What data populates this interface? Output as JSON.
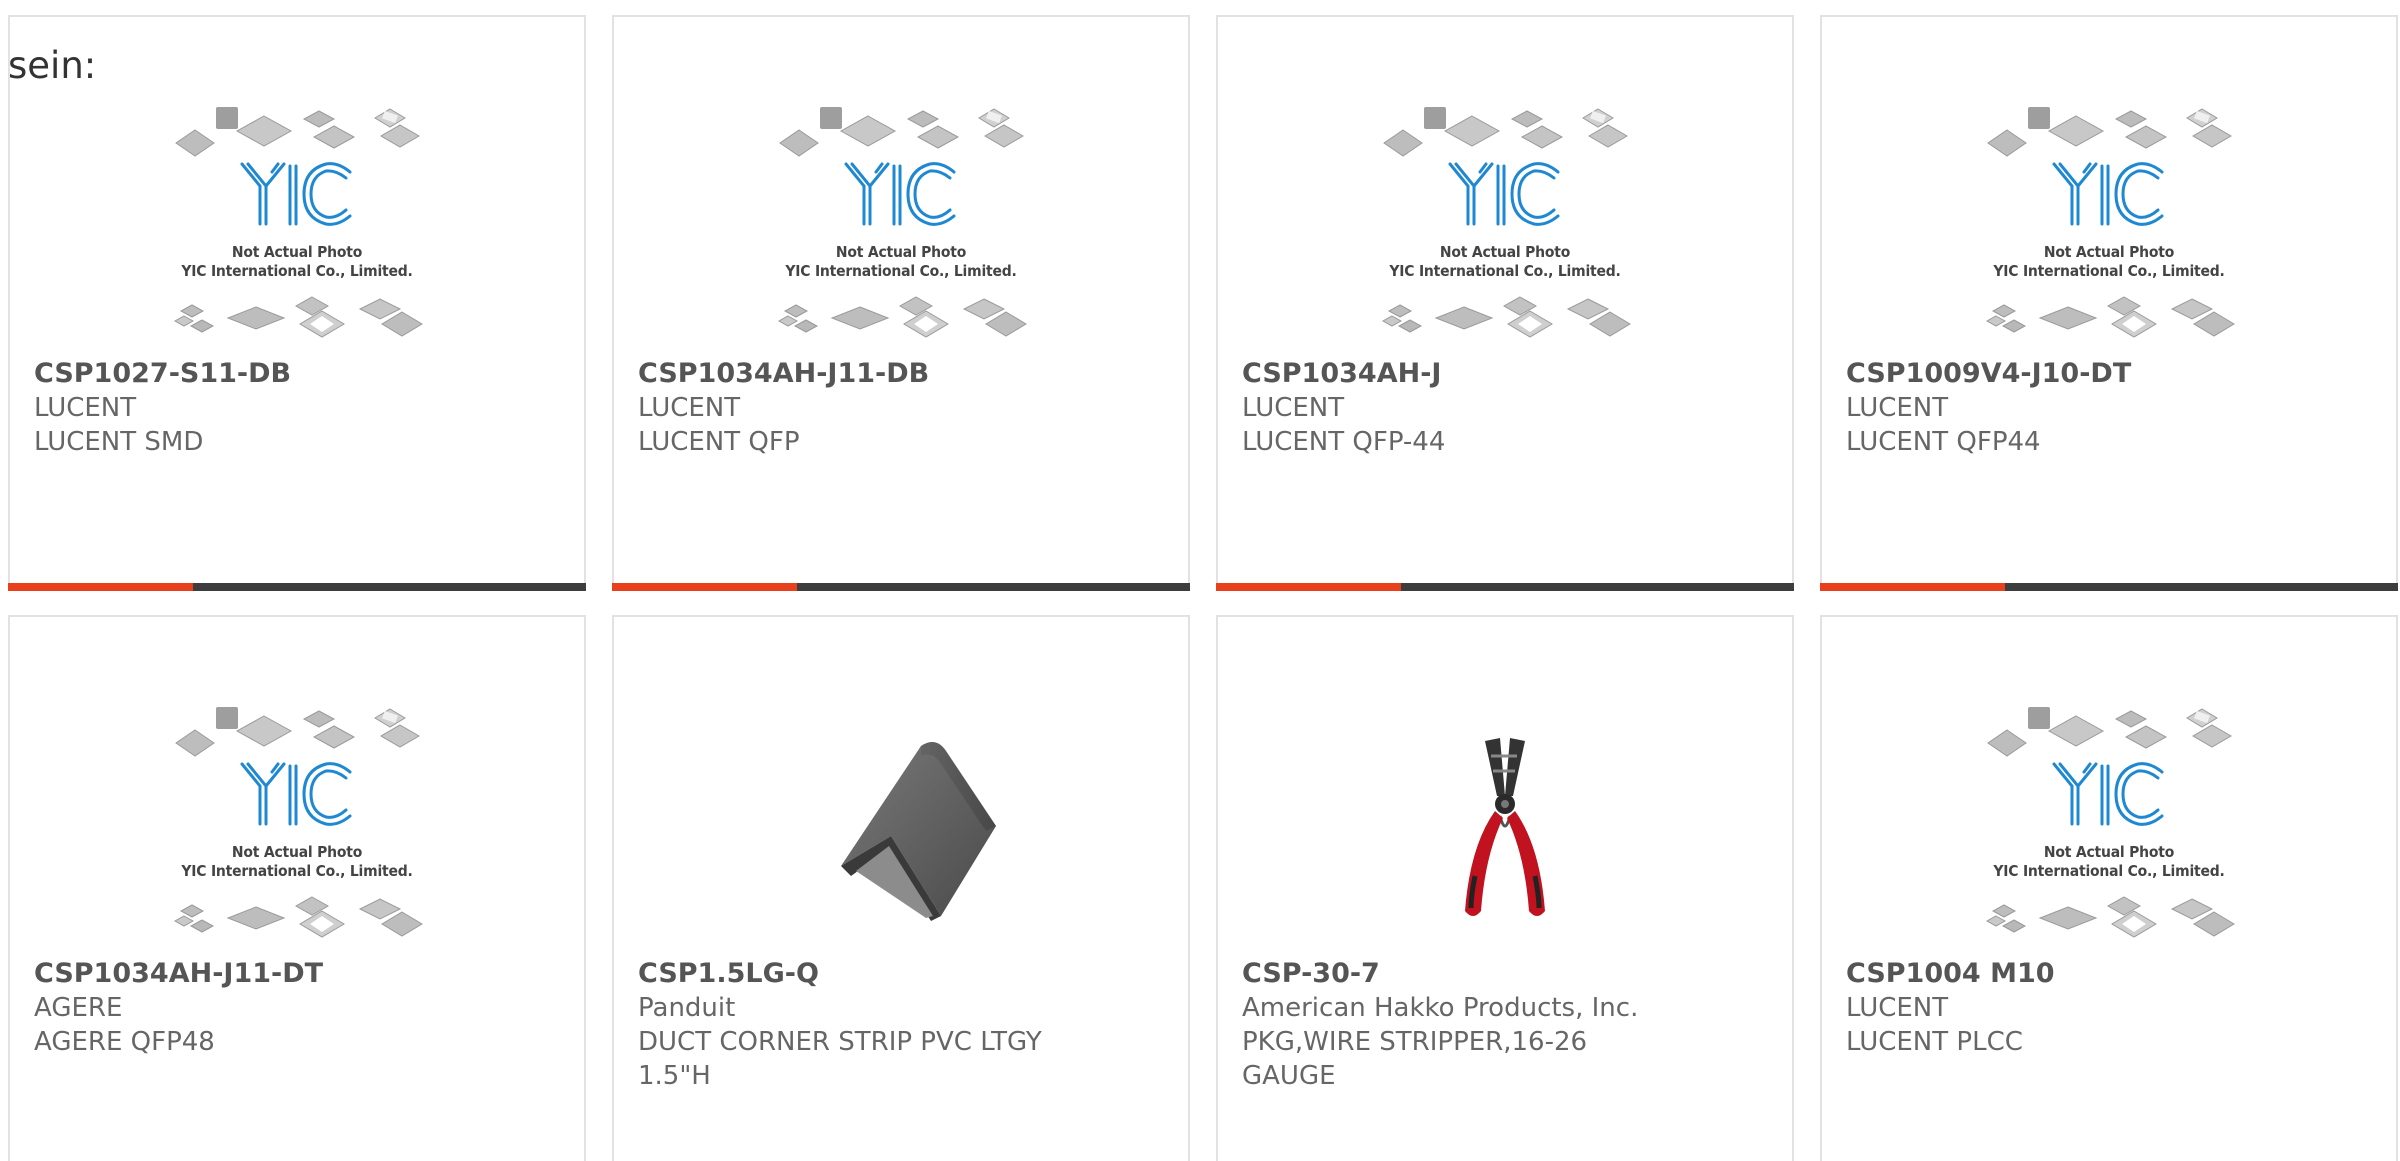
{
  "lead_text": "sein:",
  "placeholder": {
    "line1": "Not Actual Photo",
    "line2": "YIC International Co., Limited.",
    "logo_text": "YIC"
  },
  "colors": {
    "accent": "#e8401c",
    "bar": "#3d3d3d",
    "logo_blue": "#1e88d2"
  },
  "products": [
    {
      "part": "CSP1027-S11-DB",
      "maker": "LUCENT",
      "desc": "LUCENT SMD",
      "image": "placeholder"
    },
    {
      "part": "CSP1034AH-J11-DB",
      "maker": "LUCENT",
      "desc": "LUCENT QFP",
      "image": "placeholder"
    },
    {
      "part": "CSP1034AH-J",
      "maker": "LUCENT",
      "desc": "LUCENT QFP-44",
      "image": "placeholder"
    },
    {
      "part": "CSP1009V4-J10-DT",
      "maker": "LUCENT",
      "desc": "LUCENT QFP44",
      "image": "placeholder"
    },
    {
      "part": "CSP1034AH-J11-DT",
      "maker": "AGERE",
      "desc": "AGERE QFP48",
      "image": "placeholder"
    },
    {
      "part": "CSP1.5LG-Q",
      "maker": "Panduit",
      "desc": "DUCT CORNER STRIP PVC LTGY 1.5\"H",
      "image": "corner-strip"
    },
    {
      "part": "CSP-30-7",
      "maker": "American Hakko Products, Inc.",
      "desc": "PKG,WIRE STRIPPER,16-26 GAUGE",
      "image": "wire-stripper"
    },
    {
      "part": "CSP1004 M10",
      "maker": "LUCENT",
      "desc": "LUCENT PLCC",
      "image": "placeholder"
    }
  ]
}
